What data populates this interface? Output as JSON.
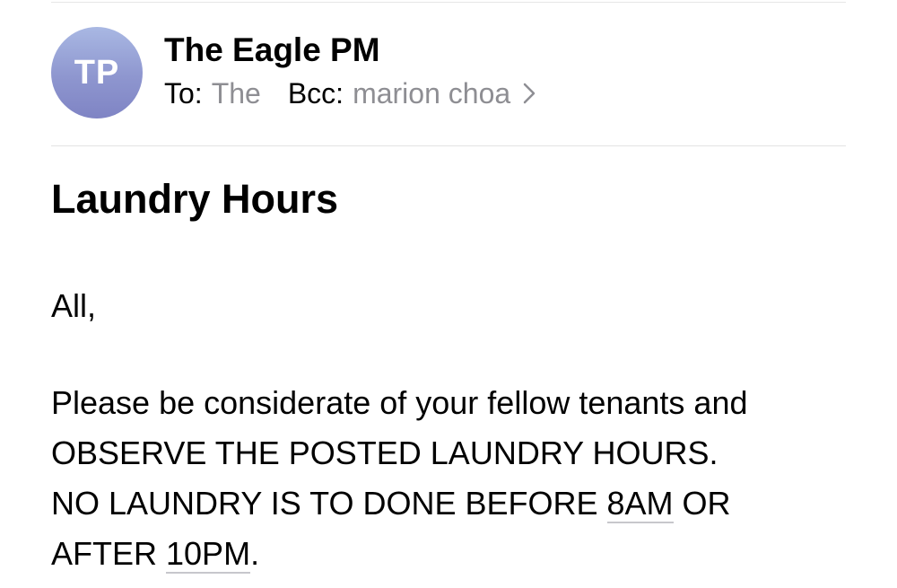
{
  "sender": {
    "avatar_initials": "TP",
    "name": "The Eagle PM"
  },
  "recipients": {
    "to_label": "To:",
    "to_value": "The",
    "bcc_label": "Bcc:",
    "bcc_value": "marion choa"
  },
  "icons": {
    "chevron": "chevron-right-icon"
  },
  "colors": {
    "avatar_gradient_top": "#a9b8e3",
    "avatar_gradient_bottom": "#7f84c4",
    "secondary_text": "#8e8e93",
    "link_underline": "#c7c7cc"
  },
  "email": {
    "subject": "Laundry Hours",
    "greeting": "All,",
    "line1": "Please be considerate of your fellow tenants and",
    "line2": "OBSERVE THE POSTED LAUNDRY HOURS.",
    "line3_before": "NO LAUNDRY IS TO DONE BEFORE ",
    "line3_time": "8AM",
    "line3_after": " OR",
    "line4_before": "AFTER ",
    "line4_time": "10PM",
    "line4_after": "."
  }
}
